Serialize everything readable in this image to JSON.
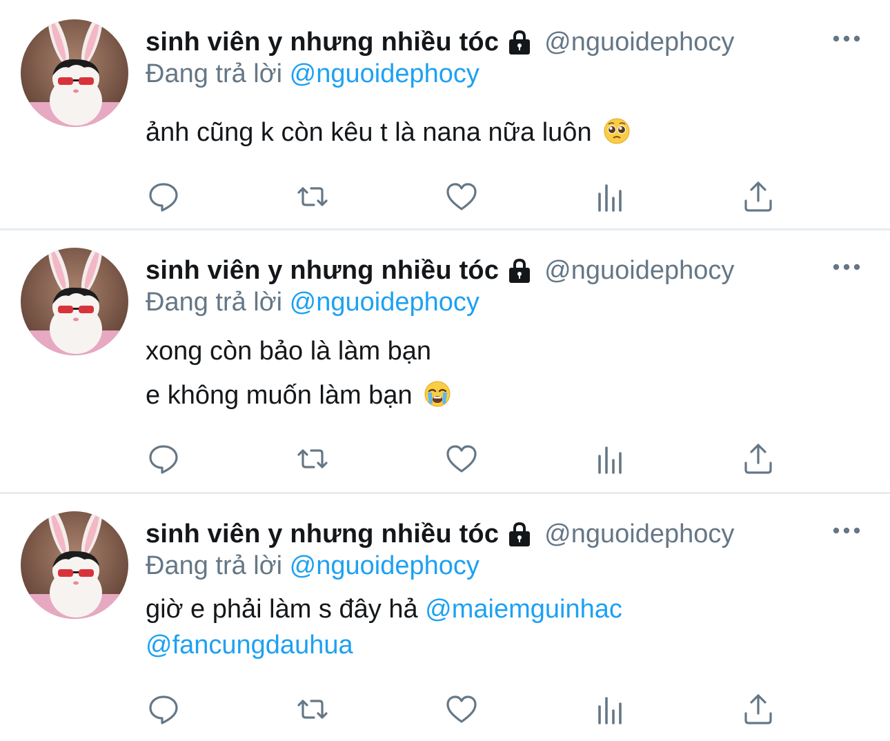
{
  "colors": {
    "text": "#14171a",
    "secondary": "#657786",
    "link": "#1da1f2",
    "divider": "#e6ecf0",
    "icon": "#657786"
  },
  "tweets": [
    {
      "author": {
        "display_name": "sinh viên y nhưng nhiều tóc",
        "handle": "@nguoidephocy",
        "avatar_icon": "bunny-avatar-icon",
        "locked_icon": "lock-icon"
      },
      "reply_prefix": "Đang trả lời",
      "reply_to": "@nguoidephocy",
      "text_lines": [
        {
          "text": "ảnh cũng k còn kêu t là nana nữa luôn",
          "emoji": "pleading-face-emoji"
        }
      ],
      "actions": [
        "reply-icon",
        "retweet-icon",
        "like-icon",
        "analytics-icon",
        "share-icon"
      ]
    },
    {
      "author": {
        "display_name": "sinh viên y nhưng nhiều tóc",
        "handle": "@nguoidephocy",
        "avatar_icon": "bunny-avatar-icon",
        "locked_icon": "lock-icon"
      },
      "reply_prefix": "Đang trả lời",
      "reply_to": "@nguoidephocy",
      "text_lines": [
        {
          "text": "xong còn bảo là làm bạn"
        },
        {
          "text": "e không muốn làm bạn",
          "emoji": "loudly-crying-face-emoji"
        }
      ],
      "actions": [
        "reply-icon",
        "retweet-icon",
        "like-icon",
        "analytics-icon",
        "share-icon"
      ]
    },
    {
      "author": {
        "display_name": "sinh viên y nhưng nhiều tóc",
        "handle": "@nguoidephocy",
        "avatar_icon": "bunny-avatar-icon",
        "locked_icon": "lock-icon"
      },
      "reply_prefix": "Đang trả lời",
      "reply_to": "@nguoidephocy",
      "text_lines": [
        {
          "text": "giờ e phải làm s đây hả ",
          "mention": "@maiemguinhac"
        },
        {
          "mention": "@fancungdauhua"
        }
      ],
      "actions": [
        "reply-icon",
        "retweet-icon",
        "like-icon",
        "analytics-icon",
        "share-icon"
      ]
    }
  ]
}
